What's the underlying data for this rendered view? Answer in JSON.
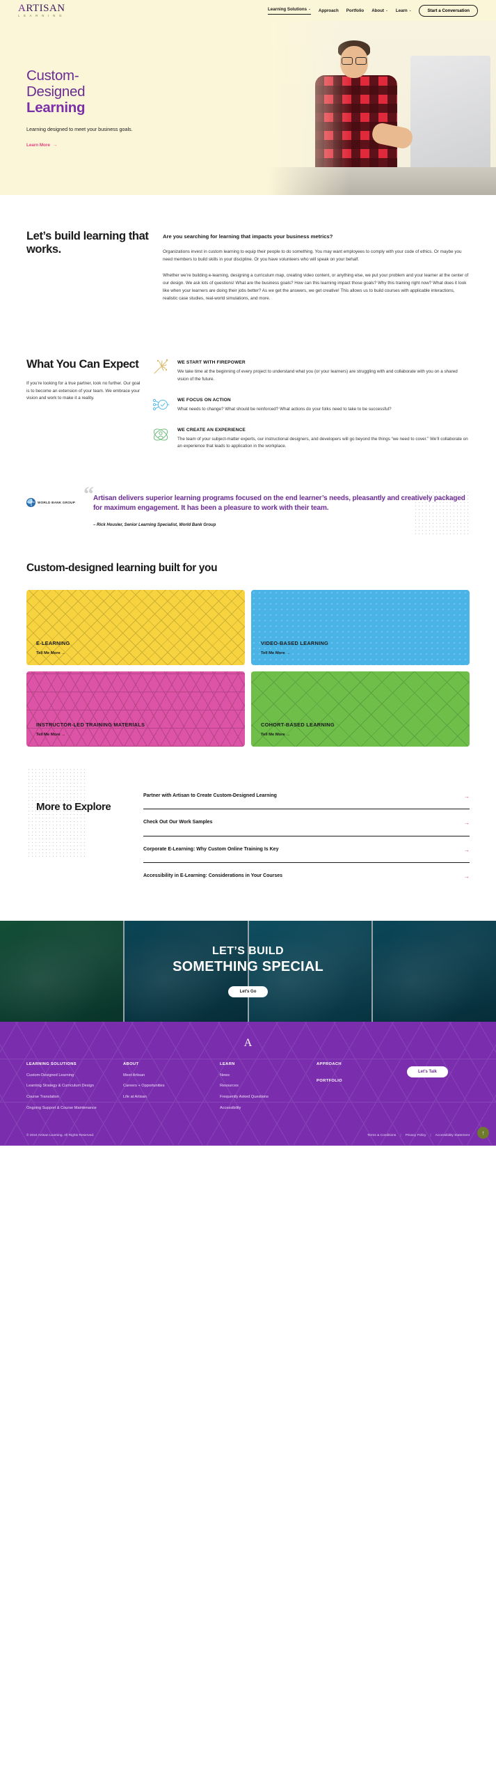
{
  "header": {
    "logo_main": "ARTISAN",
    "logo_first": "A",
    "logo_rest": "RTISAN",
    "logo_sub": "L E A R N I N G",
    "nav": [
      {
        "label": "Learning Solutions",
        "caret": "⌄",
        "active": true
      },
      {
        "label": "Approach",
        "caret": "",
        "active": false
      },
      {
        "label": "Portfolio",
        "caret": "",
        "active": false
      },
      {
        "label": "About",
        "caret": "⌄",
        "active": false
      },
      {
        "label": "Learn",
        "caret": "⌄",
        "active": false
      }
    ],
    "cta": "Start a Conversation"
  },
  "hero": {
    "line1": "Custom-",
    "line2": "Designed",
    "line3": "Learning",
    "subtitle": "Learning designed to meet your business goals.",
    "link": "Learn More",
    "arrow": "→"
  },
  "build": {
    "heading": "Let’s build learning that works.",
    "lead": "Are you searching for learning that impacts your business metrics?",
    "p1": "Organizations invest in custom learning to equip their people to do something. You may want employees to comply with your code of ethics. Or maybe you need members to build skills in your discipline. Or you have volunteers who will speak on your behalf.",
    "p2": "Whether we’re building e-learning, designing a curriculum map, creating video content, or anything else, we put your problem and your learner at the center of our design. We ask lots of questions! What are the business goals? How can this learning impact those goals? Why this training right now? What does it look like when your learners are doing their jobs better? As we get the answers, we get creative! This allows us to build courses with applicable interactions, realistic case studies, real-world simulations, and more."
  },
  "expect": {
    "heading": "What You Can Expect",
    "paragraph": "If you’re looking for a true partner, look no further. Our goal is to become an extension of your team. We embrace your vision and work to make it a reality.",
    "features": [
      {
        "icon": "sparkler-wand-icon",
        "title": "WE START WITH FIREPOWER",
        "body": "We take time at the beginning of every project to understand what you (or your learners) are struggling with and collaborate with you on a shared vision of the future."
      },
      {
        "icon": "process-check-icon",
        "title": "WE FOCUS ON ACTION",
        "body": "What needs to change? What should be reinforced? What actions do your folks need to take to be successful?"
      },
      {
        "icon": "atom-person-icon",
        "title": "WE CREATE AN EXPERIENCE",
        "body": "The team of your subject-matter experts, our instructional designers, and developers will go beyond the things “we need to cover.” We’ll collaborate on an experience that leads to application in the workplace."
      }
    ]
  },
  "testimonial": {
    "logo_text": "WORLD BANK GROUP",
    "quote_mark": "“",
    "quote": "Artisan delivers superior learning programs focused on the end learner’s needs, pleasantly and creatively packaged for maximum engagement. It has been a pleasure to work with their team.",
    "attribution": "– Rick Housler, Senior Learning Specialist, World Bank Group"
  },
  "cards": {
    "heading": "Custom-designed learning built for you",
    "cta_arrow": "→",
    "items": [
      {
        "title": "E-LEARNING",
        "cta": "Tell Me More →",
        "color": "#F7D33F",
        "theme": "c-yellow",
        "pattern": "pat-diag"
      },
      {
        "title": "VIDEO-BASED LEARNING",
        "cta": "Tell Me More →",
        "color": "#4BB4E6",
        "theme": "c-blue",
        "pattern": "pat-dots"
      },
      {
        "title": "INSTRUCTOR-LED TRAINING MATERIALS",
        "cta": "Tell Me More →",
        "color": "#DD54A6",
        "theme": "c-pink",
        "pattern": "pat-cube"
      },
      {
        "title": "COHORT-BASED LEARNING",
        "cta": "Tell Me More →",
        "color": "#6FBE4A",
        "theme": "c-green",
        "pattern": "pat-x"
      }
    ]
  },
  "explore": {
    "heading": "More to Explore",
    "arrow": "→",
    "links": [
      "Partner with Artisan to Create Custom-Designed Learning",
      "Check Out Our Work Samples",
      "Corporate E-Learning: Why Custom Online Training Is Key",
      "Accessibility in E-Learning: Considerations in Your Courses"
    ]
  },
  "banner": {
    "line1": "LET’S BUILD",
    "line2": "SOMETHING SPECIAL",
    "button": "Let’s Go"
  },
  "footer": {
    "logo": "A",
    "columns": [
      {
        "title": "LEARNING SOLUTIONS",
        "links": [
          "Custom-Designed Learning",
          "Learning Strategy & Curriculum Design",
          "Course Translation",
          "Ongoing Support & Course Maintenance"
        ]
      },
      {
        "title": "ABOUT",
        "links": [
          "Meet Artisan",
          "Careers + Opportunities",
          "Life at Artisan"
        ]
      },
      {
        "title": "LEARN",
        "links": [
          "News",
          "Resources",
          "Frequently Asked Questions",
          "Accessibility"
        ]
      }
    ],
    "approach_title": "APPROACH",
    "portfolio_title": "PORTFOLIO",
    "cta": "Let’s Talk",
    "copyright": "© 2024 Artisan Learning. All Rights Reserved.",
    "legal": [
      "Terms & Conditions",
      "Privacy Policy",
      "Accessibility Statement"
    ],
    "separator": "|",
    "to_top": "↑"
  },
  "colors": {
    "cream": "#FCF6D9",
    "purple": "#6A2C91",
    "purple_bold": "#7B2FA8",
    "pink": "#E0417F",
    "footer_purple": "#7A2EAE"
  }
}
